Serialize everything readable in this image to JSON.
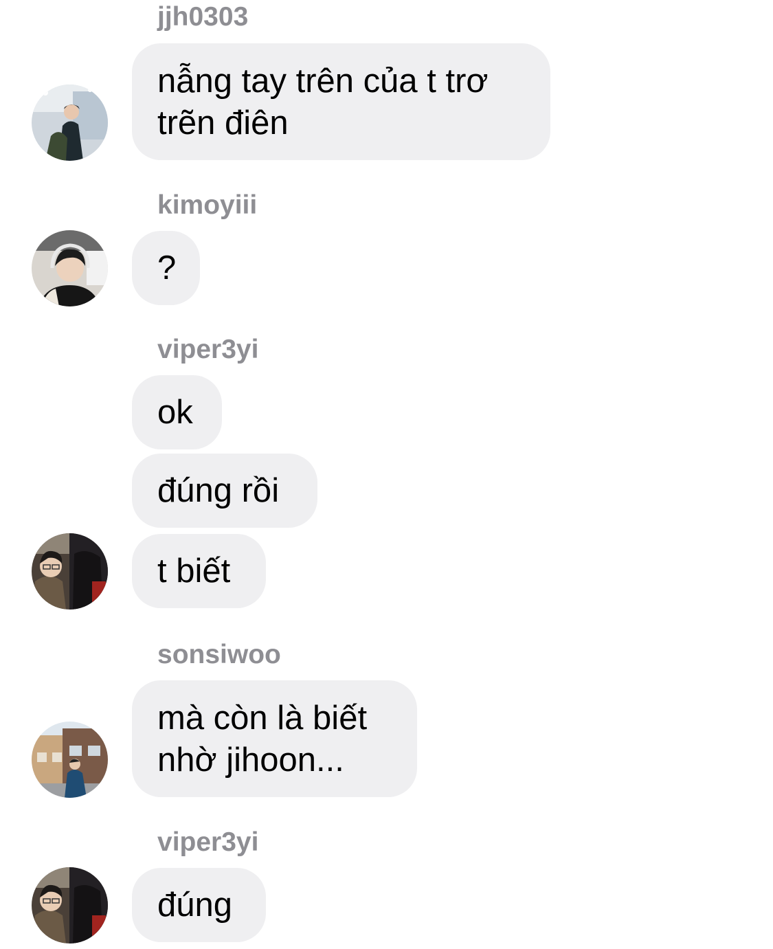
{
  "messages": [
    {
      "sender": "jjh0303",
      "bubbles": [
        "nẫng tay trên của t trơ\ntrẽn điên"
      ]
    },
    {
      "sender": "kimoyiii",
      "bubbles": [
        "?"
      ]
    },
    {
      "sender": "viper3yi",
      "bubbles": [
        "ok",
        "đúng rồi",
        "t biết"
      ]
    },
    {
      "sender": "sonsiwoo",
      "bubbles": [
        "mà còn là biết\nnhờ jihoon..."
      ]
    },
    {
      "sender": "viper3yi",
      "bubbles": [
        "đúng"
      ]
    }
  ],
  "colors": {
    "background": "#ffffff",
    "bubble": "#efeff1",
    "sender_name": "#8e8e93",
    "text": "#000000"
  },
  "icons": {
    "avatar_jjh0303": "user-avatar-photo",
    "avatar_kimoyiii": "user-avatar-photo",
    "avatar_viper3yi": "user-avatar-photo",
    "avatar_sonsiwoo": "user-avatar-photo"
  }
}
